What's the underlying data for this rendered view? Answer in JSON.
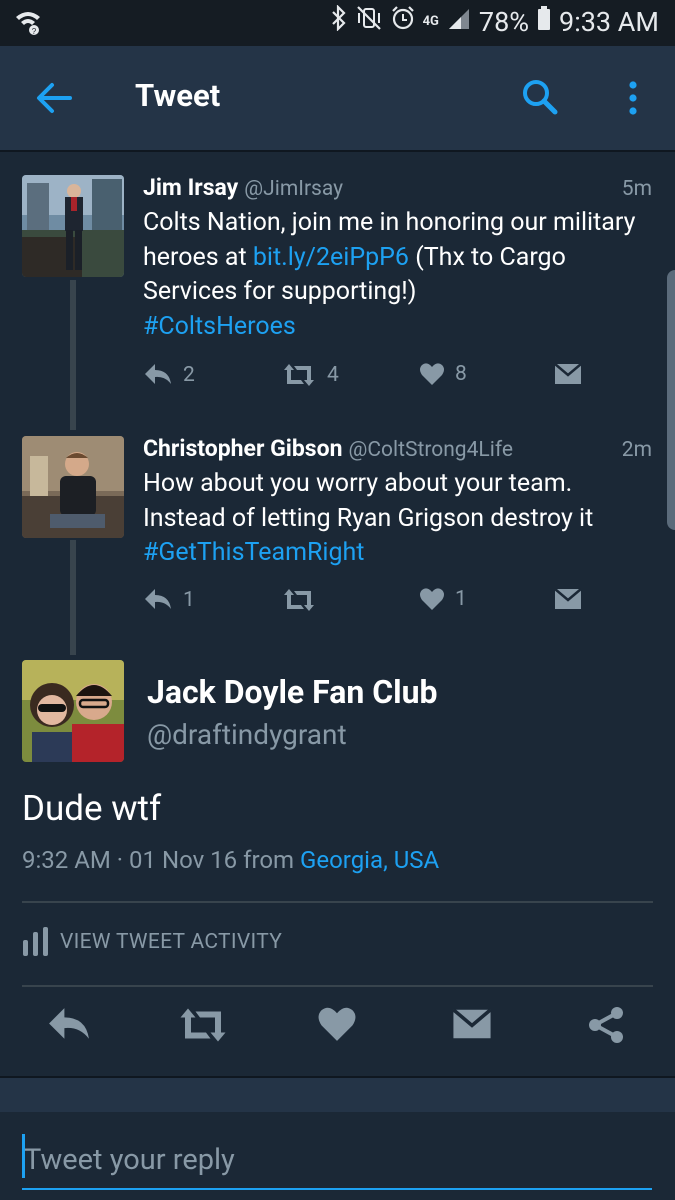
{
  "status_bar": {
    "network": "4G",
    "battery": "78%",
    "time": "9:33 AM"
  },
  "toolbar": {
    "title": "Tweet"
  },
  "thread": [
    {
      "name": "Jim Irsay",
      "handle": "@JimIrsay",
      "time": "5m",
      "text_before_link": "Colts Nation, join me in honoring our military heroes at ",
      "link": "bit.ly/2eiPpP6",
      "text_after_link": "  (Thx to Cargo Services for supporting!)",
      "hashtag": "#ColtsHeroes",
      "replies": "2",
      "retweets": "4",
      "likes": "8"
    },
    {
      "name": "Christopher Gibson",
      "handle": "@ColtStrong4Life",
      "time": "2m",
      "text": "How about you worry about your team. Instead of letting Ryan Grigson destroy it",
      "hashtag": "#GetThisTeamRight",
      "replies": "1",
      "retweets": "",
      "likes": "1"
    }
  ],
  "main_tweet": {
    "name": "Jack Doyle Fan Club",
    "handle": "@draftindygrant",
    "text": "Dude wtf",
    "timestamp": "9:32 AM · 01 Nov 16",
    "from_label": "from",
    "location": "Georgia, USA",
    "activity_label": "VIEW TWEET ACTIVITY"
  },
  "reply": {
    "placeholder": "Tweet your reply"
  },
  "colors": {
    "background": "#1b2836",
    "toolbar": "#243447",
    "accent": "#1da1f2",
    "muted": "#8899a6"
  }
}
